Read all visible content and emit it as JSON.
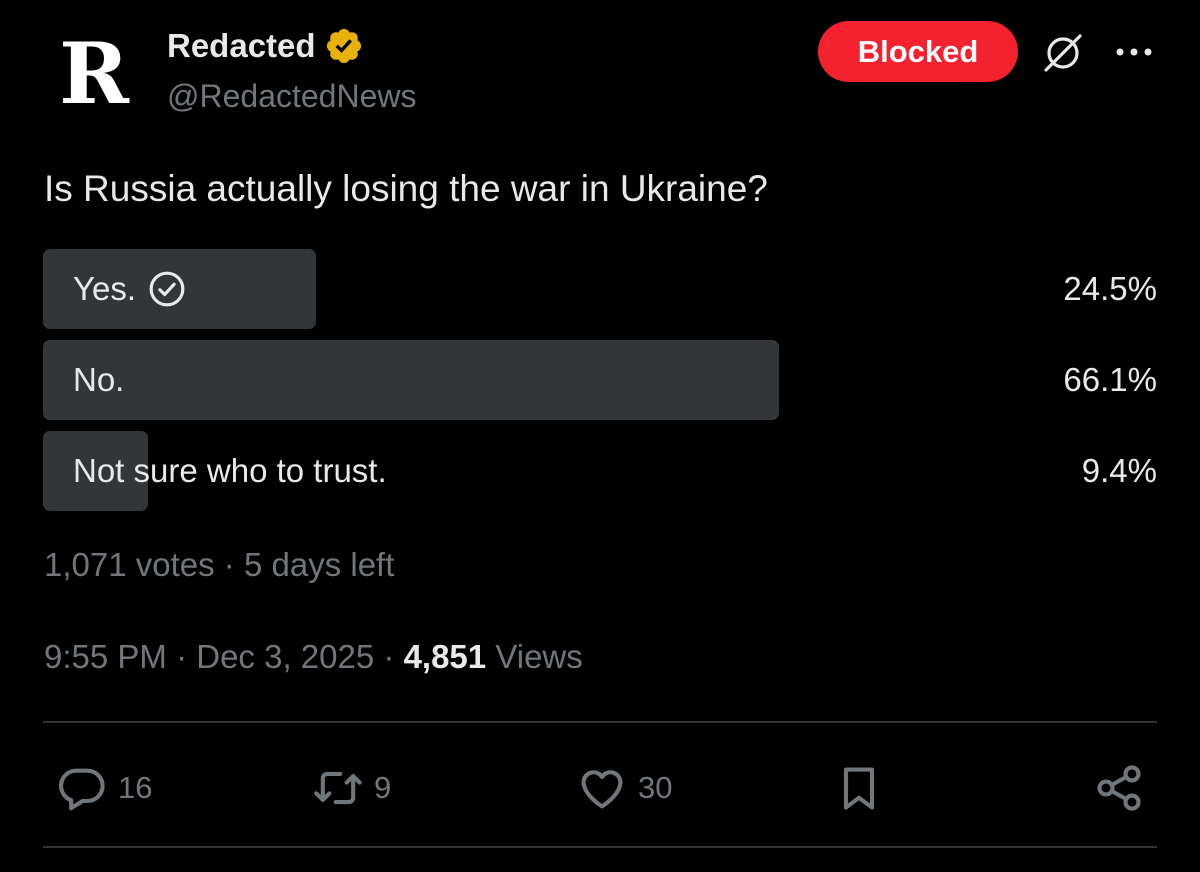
{
  "author": {
    "avatar_letter": "R",
    "name": "Redacted",
    "handle": "@RedactedNews",
    "verified_badge_color": "#e8b10b"
  },
  "header": {
    "blocked_label": "Blocked",
    "blocked_color": "#f4212e",
    "grok_icon": "grok-icon",
    "more_icon": "more-icon"
  },
  "post": {
    "text": "Is Russia actually losing the war in Ukraine?"
  },
  "poll": {
    "options": [
      {
        "label": "Yes.",
        "percent_text": "24.5%",
        "percent": 24.5,
        "selected": true
      },
      {
        "label": "No.",
        "percent_text": "66.1%",
        "percent": 66.1,
        "selected": false
      },
      {
        "label": "Not sure who to trust.",
        "percent_text": "9.4%",
        "percent": 9.4,
        "selected": false
      }
    ],
    "votes": "1,071 votes",
    "separator": "·",
    "time_left": "5 days left"
  },
  "meta": {
    "time": "9:55 PM",
    "date": "Dec 3, 2025",
    "views_count": "4,851",
    "views_label": "Views"
  },
  "actions": {
    "replies": "16",
    "reposts": "9",
    "likes": "30"
  }
}
